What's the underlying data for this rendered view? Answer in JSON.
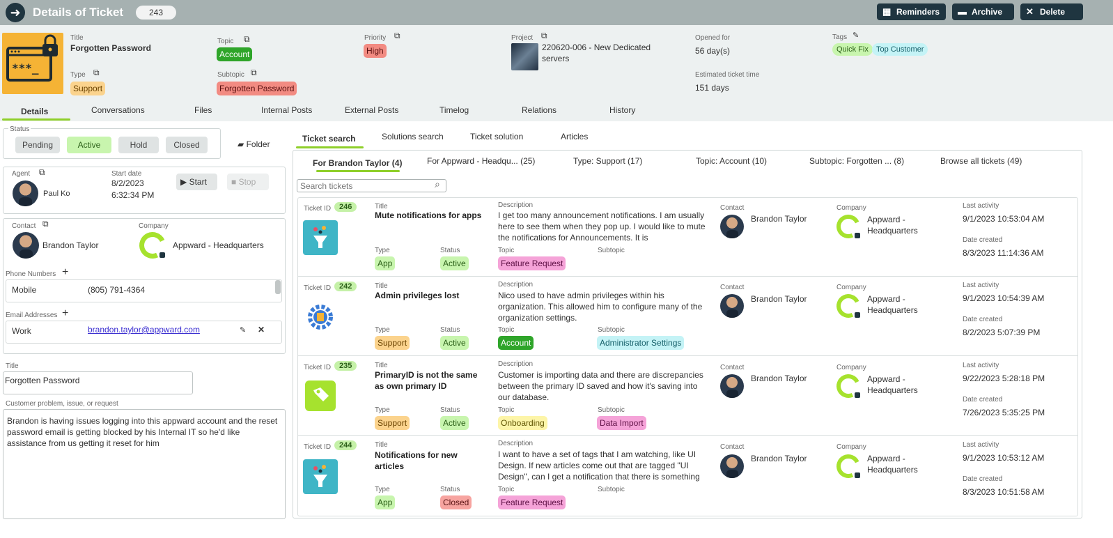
{
  "header": {
    "title": "Details of Ticket",
    "count": "243",
    "buttons": {
      "reminders": "Reminders",
      "archive": "Archive",
      "delete": "Delete"
    }
  },
  "ticket": {
    "title_label": "Title",
    "title": "Forgotten Password",
    "type_label": "Type",
    "type": "Support",
    "topic_label": "Topic",
    "topic": "Account",
    "subtopic_label": "Subtopic",
    "subtopic": "Forgotten Password",
    "priority_label": "Priority",
    "priority": "High",
    "project_label": "Project",
    "project": "220620-006 - New Dedicated servers",
    "opened_label": "Opened for",
    "opened": "56 day(s)",
    "estimated_label": "Estimated ticket time",
    "estimated": "151 days",
    "tags_label": "Tags",
    "tags": [
      "Quick Fix",
      "Top Customer"
    ]
  },
  "main_tabs": [
    "Details",
    "Conversations",
    "Files",
    "Internal Posts",
    "External Posts",
    "Timelog",
    "Relations",
    "History"
  ],
  "status": {
    "label": "Status",
    "options": [
      "Pending",
      "Active",
      "Hold",
      "Closed"
    ],
    "folder": "Folder"
  },
  "agent": {
    "label": "Agent",
    "name": "Paul Ko",
    "start_label": "Start date",
    "start_date": "8/2/2023",
    "start_time": "6:32:34 PM",
    "start_btn": "Start",
    "stop_btn": "Stop"
  },
  "contact": {
    "label": "Contact",
    "name": "Brandon Taylor",
    "company_label": "Company",
    "company": "Appward - Headquarters",
    "phone_label": "Phone Numbers",
    "phone_type": "Mobile",
    "phone": "(805) 791-4364",
    "email_label": "Email Addresses",
    "email_type": "Work",
    "email": "brandon.taylor@appward.com"
  },
  "form": {
    "title_label": "Title",
    "title_value": "Forgotten Password",
    "problem_label": "Customer problem, issue, or request",
    "problem_value": "Brandon is having issues logging into this appward account and the reset password email is getting blocked by his Internal IT so he'd like assistance from us getting it reset for him"
  },
  "right_tabs": [
    "Ticket search",
    "Solutions search",
    "Ticket solution",
    "Articles"
  ],
  "filter_tabs": [
    "For Brandon Taylor (4)",
    "For Appward - Headqu... (25)",
    "Type: Support (17)",
    "Topic: Account (10)",
    "Subtopic: Forgotten ... (8)",
    "Browse all tickets (49)"
  ],
  "search_placeholder": "Search tickets",
  "col_labels": {
    "ticket_id": "Ticket ID",
    "title": "Title",
    "description": "Description",
    "type": "Type",
    "status": "Status",
    "topic": "Topic",
    "subtopic": "Subtopic",
    "contact": "Contact",
    "company": "Company",
    "last_activity": "Last activity",
    "date_created": "Date created"
  },
  "tickets": [
    {
      "id": "246",
      "title": "Mute notifications for apps",
      "description": "I get too many announcement notifications. I am usually here to see them when they pop up. I would like to mute the notifications for Announcements. It is",
      "type": "App",
      "status": "Active",
      "topic": "Feature Request",
      "subtopic": "",
      "contact": "Brandon Taylor",
      "company": "Appward - Headquarters",
      "last_activity": "9/1/2023 10:53:04 AM",
      "date_created": "8/3/2023 11:14:36 AM"
    },
    {
      "id": "242",
      "title": "Admin privileges lost",
      "description": "Nico used to have admin privileges within his organization. This allowed him to configure many of the organization settings.",
      "type": "Support",
      "status": "Active",
      "topic": "Account",
      "subtopic": "Administrator Settings",
      "contact": "Brandon Taylor",
      "company": "Appward - Headquarters",
      "last_activity": "9/1/2023 10:54:39 AM",
      "date_created": "8/2/2023 5:07:39 PM"
    },
    {
      "id": "235",
      "title": "PrimaryID is not the same as own primary ID",
      "description": "Customer is importing data and there are discrepancies between the primary ID saved and how it's saving into our database.",
      "type": "Support",
      "status": "Active",
      "topic": "Onboarding",
      "subtopic": "Data Import",
      "contact": "Brandon Taylor",
      "company": "Appward - Headquarters",
      "last_activity": "9/22/2023 5:28:18 PM",
      "date_created": "7/26/2023 5:35:25 PM"
    },
    {
      "id": "244",
      "title": "Notifications for new articles",
      "description": "I want to have a set of tags that I am watching, like UI Design. If new articles come out that are tagged \"UI Design\", can I get a notification that there is something",
      "type": "App",
      "status": "Closed",
      "topic": "Feature Request",
      "subtopic": "",
      "contact": "Brandon Taylor",
      "company": "Appward - Headquarters",
      "last_activity": "9/1/2023 10:53:12 AM",
      "date_created": "8/3/2023 10:51:58 AM"
    }
  ]
}
